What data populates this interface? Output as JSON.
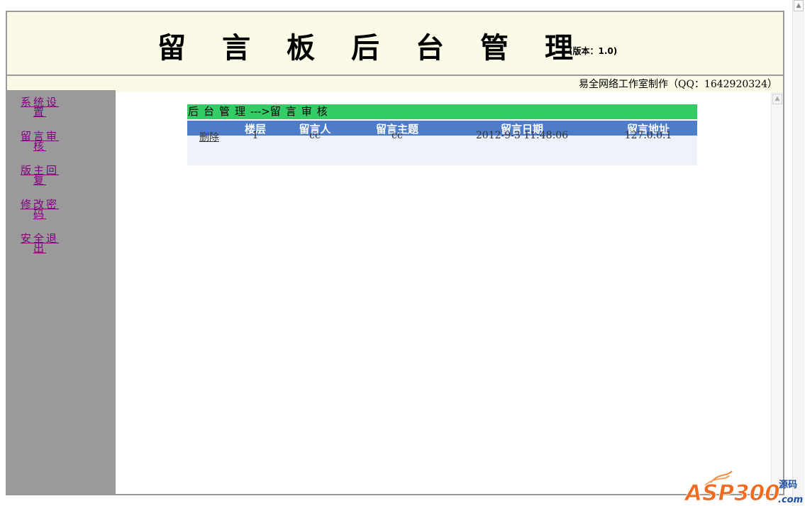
{
  "header": {
    "title": "留言板后台管理",
    "version": "(版本：1.0)",
    "credit": "易全网络工作室制作（QQ：1642920324）"
  },
  "sidebar": {
    "items": [
      {
        "label": "系统设置"
      },
      {
        "label": "留言审核"
      },
      {
        "label": "版主回复"
      },
      {
        "label": "修改密码"
      },
      {
        "label": "安全退出"
      }
    ]
  },
  "breadcrumb": {
    "section": "后台管理",
    "arrow": "--->",
    "page": "留言审核"
  },
  "table": {
    "headers": [
      "",
      "楼层",
      "留言人",
      "留言主题",
      "留言日期",
      "留言地址"
    ],
    "rows": [
      {
        "action": "删除",
        "floor": "1",
        "author": "cc",
        "subject": "cc",
        "date": "2012-9-3 11:48:06",
        "address": "127.0.0.1"
      }
    ]
  },
  "watermark": {
    "brand": "ASP300",
    "cn": "源码",
    "suffix": ".com"
  },
  "colors": {
    "header_bg": "#fafae6",
    "sidebar_bg": "#9a9a9a",
    "breadcrumb_bg": "#33cc66",
    "table_header_bg": "#4e7cc9",
    "link_visited": "#800080"
  }
}
